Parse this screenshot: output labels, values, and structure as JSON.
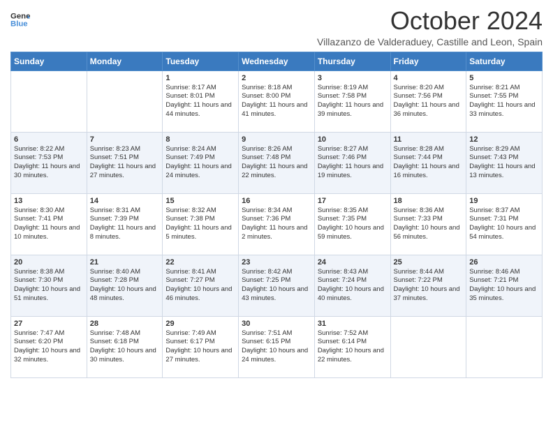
{
  "header": {
    "logo_line1": "General",
    "logo_line2": "Blue",
    "title": "October 2024",
    "subtitle": "Villazanzo de Valderaduey, Castille and Leon, Spain"
  },
  "weekdays": [
    "Sunday",
    "Monday",
    "Tuesday",
    "Wednesday",
    "Thursday",
    "Friday",
    "Saturday"
  ],
  "weeks": [
    [
      {
        "day": "",
        "info": ""
      },
      {
        "day": "",
        "info": ""
      },
      {
        "day": "1",
        "info": "Sunrise: 8:17 AM\nSunset: 8:01 PM\nDaylight: 11 hours and 44 minutes."
      },
      {
        "day": "2",
        "info": "Sunrise: 8:18 AM\nSunset: 8:00 PM\nDaylight: 11 hours and 41 minutes."
      },
      {
        "day": "3",
        "info": "Sunrise: 8:19 AM\nSunset: 7:58 PM\nDaylight: 11 hours and 39 minutes."
      },
      {
        "day": "4",
        "info": "Sunrise: 8:20 AM\nSunset: 7:56 PM\nDaylight: 11 hours and 36 minutes."
      },
      {
        "day": "5",
        "info": "Sunrise: 8:21 AM\nSunset: 7:55 PM\nDaylight: 11 hours and 33 minutes."
      }
    ],
    [
      {
        "day": "6",
        "info": "Sunrise: 8:22 AM\nSunset: 7:53 PM\nDaylight: 11 hours and 30 minutes."
      },
      {
        "day": "7",
        "info": "Sunrise: 8:23 AM\nSunset: 7:51 PM\nDaylight: 11 hours and 27 minutes."
      },
      {
        "day": "8",
        "info": "Sunrise: 8:24 AM\nSunset: 7:49 PM\nDaylight: 11 hours and 24 minutes."
      },
      {
        "day": "9",
        "info": "Sunrise: 8:26 AM\nSunset: 7:48 PM\nDaylight: 11 hours and 22 minutes."
      },
      {
        "day": "10",
        "info": "Sunrise: 8:27 AM\nSunset: 7:46 PM\nDaylight: 11 hours and 19 minutes."
      },
      {
        "day": "11",
        "info": "Sunrise: 8:28 AM\nSunset: 7:44 PM\nDaylight: 11 hours and 16 minutes."
      },
      {
        "day": "12",
        "info": "Sunrise: 8:29 AM\nSunset: 7:43 PM\nDaylight: 11 hours and 13 minutes."
      }
    ],
    [
      {
        "day": "13",
        "info": "Sunrise: 8:30 AM\nSunset: 7:41 PM\nDaylight: 11 hours and 10 minutes."
      },
      {
        "day": "14",
        "info": "Sunrise: 8:31 AM\nSunset: 7:39 PM\nDaylight: 11 hours and 8 minutes."
      },
      {
        "day": "15",
        "info": "Sunrise: 8:32 AM\nSunset: 7:38 PM\nDaylight: 11 hours and 5 minutes."
      },
      {
        "day": "16",
        "info": "Sunrise: 8:34 AM\nSunset: 7:36 PM\nDaylight: 11 hours and 2 minutes."
      },
      {
        "day": "17",
        "info": "Sunrise: 8:35 AM\nSunset: 7:35 PM\nDaylight: 10 hours and 59 minutes."
      },
      {
        "day": "18",
        "info": "Sunrise: 8:36 AM\nSunset: 7:33 PM\nDaylight: 10 hours and 56 minutes."
      },
      {
        "day": "19",
        "info": "Sunrise: 8:37 AM\nSunset: 7:31 PM\nDaylight: 10 hours and 54 minutes."
      }
    ],
    [
      {
        "day": "20",
        "info": "Sunrise: 8:38 AM\nSunset: 7:30 PM\nDaylight: 10 hours and 51 minutes."
      },
      {
        "day": "21",
        "info": "Sunrise: 8:40 AM\nSunset: 7:28 PM\nDaylight: 10 hours and 48 minutes."
      },
      {
        "day": "22",
        "info": "Sunrise: 8:41 AM\nSunset: 7:27 PM\nDaylight: 10 hours and 46 minutes."
      },
      {
        "day": "23",
        "info": "Sunrise: 8:42 AM\nSunset: 7:25 PM\nDaylight: 10 hours and 43 minutes."
      },
      {
        "day": "24",
        "info": "Sunrise: 8:43 AM\nSunset: 7:24 PM\nDaylight: 10 hours and 40 minutes."
      },
      {
        "day": "25",
        "info": "Sunrise: 8:44 AM\nSunset: 7:22 PM\nDaylight: 10 hours and 37 minutes."
      },
      {
        "day": "26",
        "info": "Sunrise: 8:46 AM\nSunset: 7:21 PM\nDaylight: 10 hours and 35 minutes."
      }
    ],
    [
      {
        "day": "27",
        "info": "Sunrise: 7:47 AM\nSunset: 6:20 PM\nDaylight: 10 hours and 32 minutes."
      },
      {
        "day": "28",
        "info": "Sunrise: 7:48 AM\nSunset: 6:18 PM\nDaylight: 10 hours and 30 minutes."
      },
      {
        "day": "29",
        "info": "Sunrise: 7:49 AM\nSunset: 6:17 PM\nDaylight: 10 hours and 27 minutes."
      },
      {
        "day": "30",
        "info": "Sunrise: 7:51 AM\nSunset: 6:15 PM\nDaylight: 10 hours and 24 minutes."
      },
      {
        "day": "31",
        "info": "Sunrise: 7:52 AM\nSunset: 6:14 PM\nDaylight: 10 hours and 22 minutes."
      },
      {
        "day": "",
        "info": ""
      },
      {
        "day": "",
        "info": ""
      }
    ]
  ]
}
